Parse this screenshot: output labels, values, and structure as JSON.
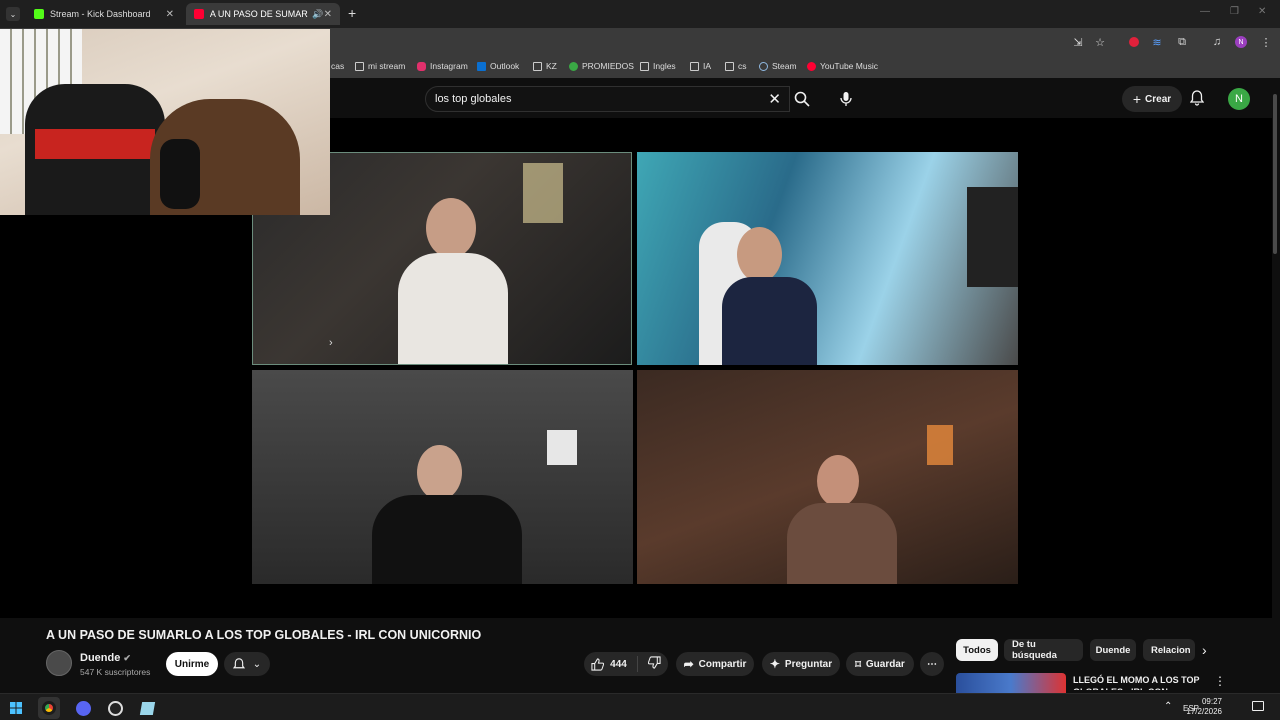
{
  "browser": {
    "tabs": [
      {
        "title": "Stream - Kick Dashboard",
        "active": false,
        "favicon_color": "#53fc18"
      },
      {
        "title": "A UN PASO DE SUMARLO A LOS TOP GLOBALES - IRL CON UNICORNIO",
        "active": true,
        "favicon_color": "#ff0033"
      }
    ],
    "new_tab_label": "+",
    "bookmarks": [
      "cas",
      "mi stream",
      "Instagram",
      "Outlook",
      "KZ",
      "PROMIEDOS",
      "Ingles",
      "IA",
      "cs",
      "Steam",
      "YouTube Music"
    ]
  },
  "youtube": {
    "search_value": "los top globales",
    "create_label": "Crear",
    "user_initial": "N",
    "video": {
      "title": "A UN PASO DE SUMARLO A LOS TOP GLOBALES - IRL CON UNICORNIO",
      "channel": "Duende",
      "subscribers": "547 K suscriptores",
      "join_label": "Unirme",
      "likes": "444",
      "share_label": "Compartir",
      "ask_label": "Preguntar",
      "save_label": "Guardar"
    },
    "chips": [
      "Todos",
      "De tu búsqueda",
      "Duende",
      "Relacion"
    ],
    "recommended": [
      {
        "title": "LLEGÓ EL MOMO A LOS TOP GLOBALES - IRL CON"
      }
    ]
  },
  "taskbar": {
    "lang": "ESP",
    "time": "09:27",
    "date": "17/2/2026"
  },
  "colors": {
    "accent_red": "#ff0033",
    "avatar_green": "#3aa845",
    "kick_green": "#53fc18"
  }
}
